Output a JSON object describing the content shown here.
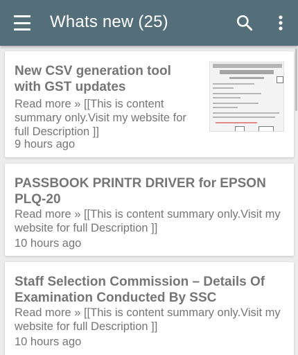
{
  "appbar": {
    "title": "Whats new (25)",
    "background": "#546e7a",
    "icons": [
      "menu-icon",
      "search-icon",
      "more-vert-icon"
    ]
  },
  "posts": [
    {
      "title": "New CSV generation tool with GST updates",
      "summary": "Read more » [[This is content summary only.Visit my website for full Description ]]",
      "time": "9 hours ago",
      "has_thumbnail": true
    },
    {
      "title": "PASSBOOK PRINTR DRIVER for EPSON PLQ-20",
      "summary": "Read more » [[This is content summary only.Visit my website for full Description ]]",
      "time": "10 hours ago",
      "has_thumbnail": false
    },
    {
      "title": "Staff Selection Commission – Details Of Examination Conducted By SSC",
      "summary": "Read more » [[This is content summary only.Visit my website for full Description ]]",
      "time": "10 hours ago",
      "has_thumbnail": false
    }
  ]
}
